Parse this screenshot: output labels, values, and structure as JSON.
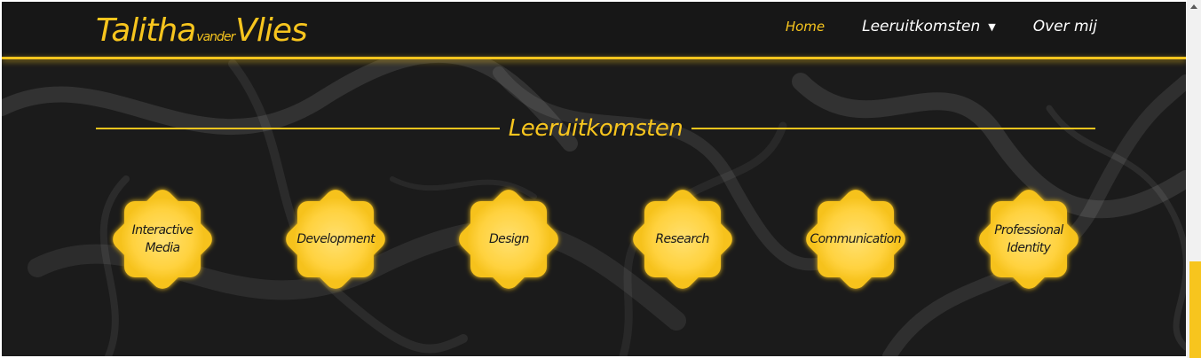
{
  "logo": {
    "first": "Talitha",
    "middle": "vander",
    "last": "Vlies"
  },
  "nav": {
    "items": [
      {
        "label": "Home",
        "active": true
      },
      {
        "label": "Leeruitkomsten",
        "dropdown": true
      },
      {
        "label": "Over mij"
      }
    ]
  },
  "section": {
    "title": "Leeruitkomsten"
  },
  "outcomes": [
    {
      "line1": "Interactive",
      "line2": "Media"
    },
    {
      "line1": "Development",
      "line2": ""
    },
    {
      "line1": "Design",
      "line2": ""
    },
    {
      "line1": "Research",
      "line2": ""
    },
    {
      "line1": "Communication",
      "line2": ""
    },
    {
      "line1": "Professional",
      "line2": "Identity"
    }
  ],
  "colors": {
    "accent": "#f7c51e",
    "background": "#1b1b1b",
    "badge": "#ffd23f"
  }
}
